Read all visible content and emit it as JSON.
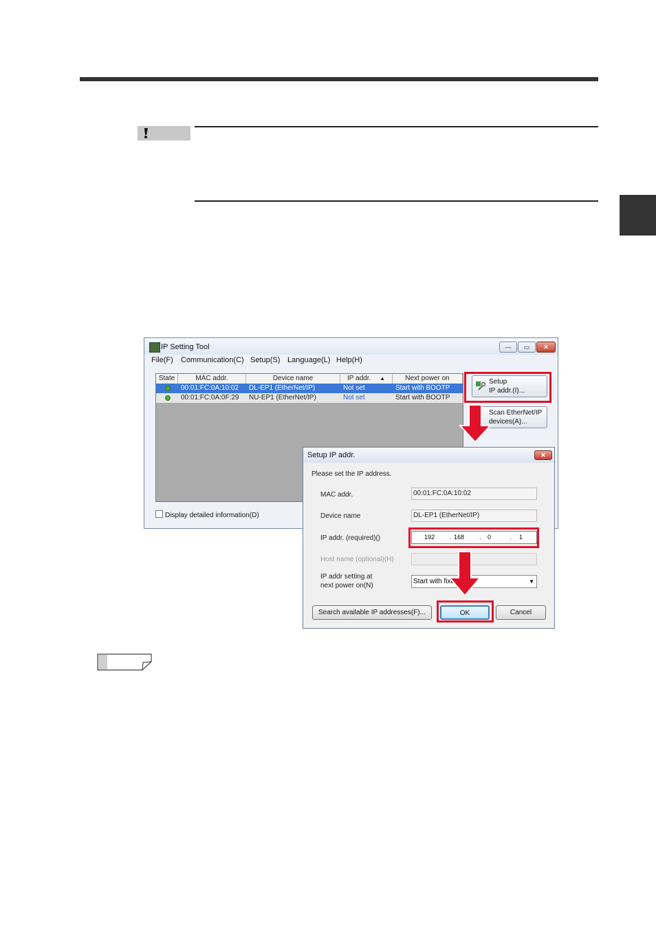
{
  "main_window": {
    "title": "IP Setting Tool",
    "controls": {
      "minimize": "—",
      "maximize": "▭",
      "close": "✕"
    },
    "menu": [
      "File(F)",
      "Communication(C)",
      "Setup(S)",
      "Language(L)",
      "Help(H)"
    ],
    "columns": [
      "State",
      "MAC addr.",
      "Device name",
      "IP addr.",
      "Next power on"
    ],
    "sort_indicator": "▲",
    "rows": [
      {
        "mac": "00:01:FC:0A:10:02",
        "device": "DL-EP1 (EtherNet/IP)",
        "ip": "Not set",
        "next": "Start with BOOTP"
      },
      {
        "mac": "00:01:FC:0A:0F:29",
        "device": "NU-EP1 (EtherNet/IP)",
        "ip": "Not set",
        "next": "Start with BOOTP"
      }
    ],
    "detail_checkbox": "Display detailed information(D)",
    "setup_button": {
      "line1": "Setup",
      "line2": "IP addr.(I)..."
    },
    "scan_button": {
      "line1": "Scan EtherNet/IP",
      "line2": "devices(A)..."
    }
  },
  "dialog": {
    "title": "Setup IP addr.",
    "close": "✕",
    "prompt": "Please set the IP address.",
    "mac_label": "MAC addr.",
    "mac_value": "00:01:FC:0A:10:02",
    "device_label": "Device name",
    "device_value": "DL-EP1 (EtherNet/IP)",
    "ip_label": "IP addr. (required)()",
    "ip_octets": [
      "192",
      "168",
      "0",
      "1"
    ],
    "ip_dot": ".",
    "host_label": "Host name (optional)(H)",
    "next_label_1": "IP addr setting at",
    "next_label_2": "next power on(N)",
    "next_value": "Start with fixe",
    "search_button": "Search available IP addresses(F)...",
    "ok_button": "OK",
    "cancel_button": "Cancel"
  },
  "colors": {
    "highlight": "#e0122a",
    "dark_bar": "#333333",
    "selection": "#3b78d8"
  }
}
